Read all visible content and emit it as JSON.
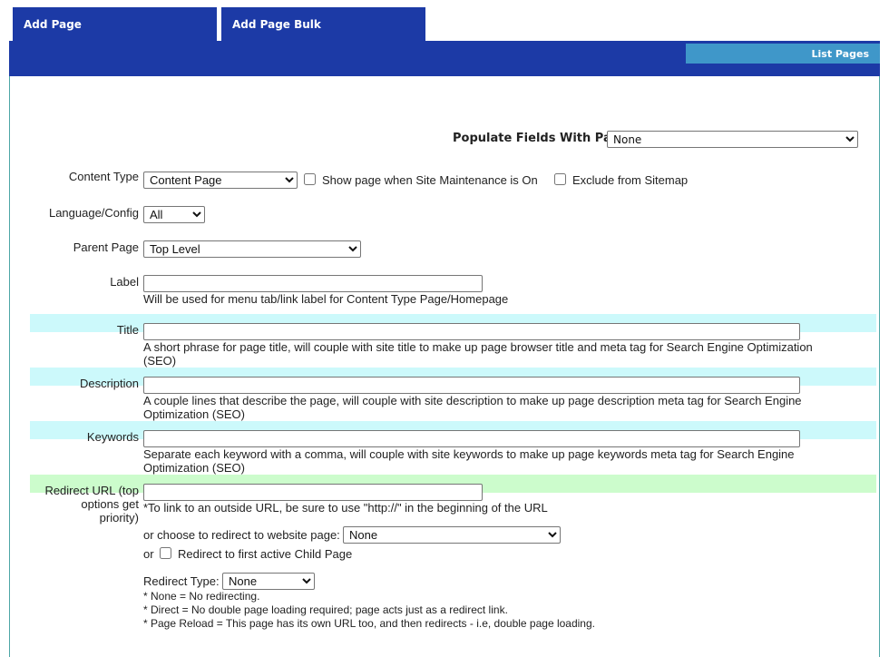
{
  "tabs": {
    "add_page": "Add Page",
    "add_page_bulk": "Add Page Bulk",
    "list_pages": "List Pages"
  },
  "populate": {
    "label": "Populate Fields With Page:",
    "value": "None"
  },
  "content_type": {
    "label": "Content Type",
    "value": "Content Page",
    "maintenance_label": "Show page when Site Maintenance is On",
    "sitemap_label": "Exclude from Sitemap"
  },
  "language": {
    "label": "Language/Config",
    "value": "All"
  },
  "parent": {
    "label": "Parent Page",
    "value": "Top Level"
  },
  "label_field": {
    "label": "Label",
    "help": "Will be used for menu tab/link label for Content Type Page/Homepage"
  },
  "title_field": {
    "label": "Title",
    "help_line1": "A short phrase for page title, will couple with site title to make up page browser title and meta tag for Search Engine Optimization",
    "help_line2": "(SEO)"
  },
  "description_field": {
    "label": "Description",
    "help_line1": "A couple lines that describe the page, will couple with site description to make up page description meta tag for Search Engine",
    "help_line2": "Optimization (SEO)"
  },
  "keywords_field": {
    "label": "Keywords",
    "help_line1": "Separate each keyword with a comma, will couple with site keywords to make up page keywords meta tag for Search Engine",
    "help_line2": "Optimization (SEO)"
  },
  "redirect": {
    "label_line1": "Redirect URL (top",
    "label_line2": "options get",
    "label_line3": "priority)",
    "help": "*To link to an outside URL, be sure to use \"http://\" in the beginning of the URL",
    "choose_label": "or choose to redirect to website page:",
    "choose_value": "None",
    "or_label": "or",
    "child_label": "Redirect to first active Child Page",
    "type_label": "Redirect Type:",
    "type_value": "None",
    "note1": "* None = No redirecting.",
    "note2": "* Direct = No double page loading required; page acts just as a redirect link.",
    "note3": "* Page Reload = This page has its own URL too, and then redirects - i.e, double page loading."
  }
}
